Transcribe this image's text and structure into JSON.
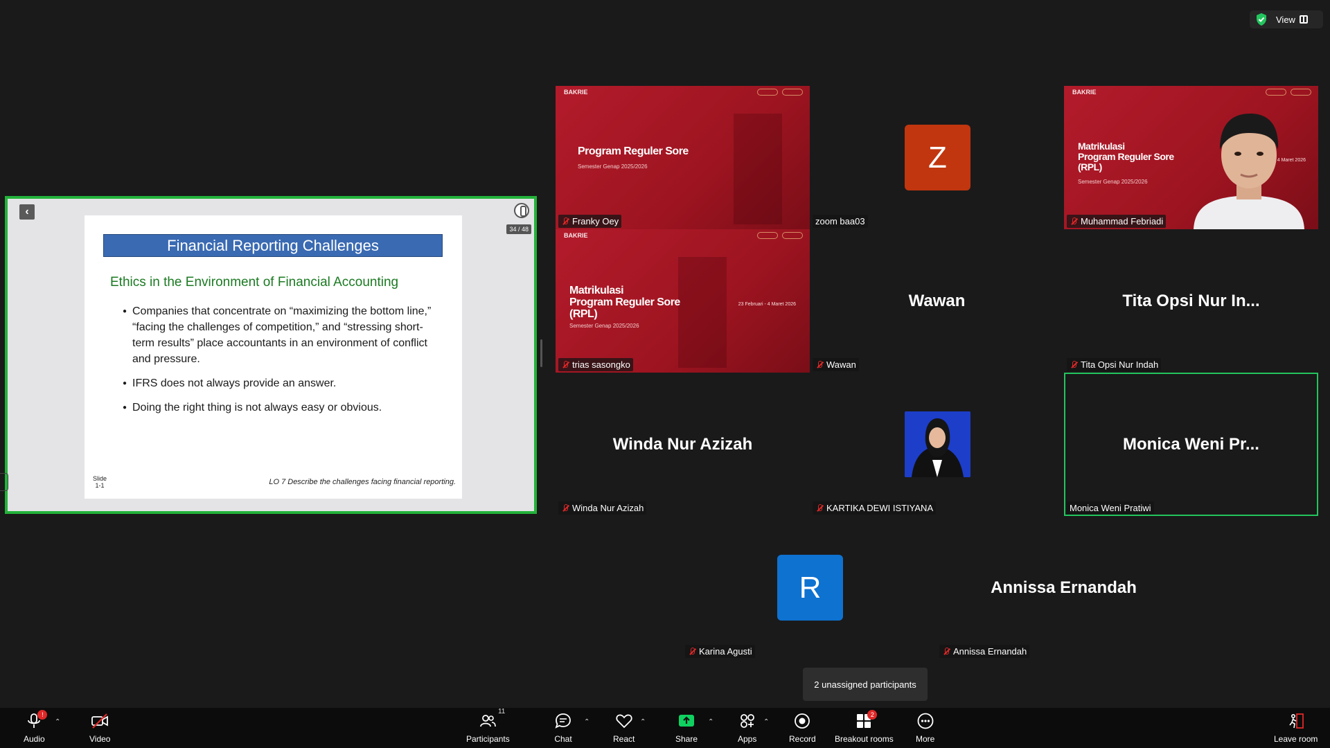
{
  "topbar": {
    "view_label": "View"
  },
  "share": {
    "page_count": "34 / 48",
    "slide_title": "Financial Reporting Challenges",
    "slide_subtitle": "Ethics in the Environment of Financial Accounting",
    "bullets": [
      "Companies that concentrate on “maximizing the bottom line,” “facing the challenges of competition,” and “stressing short-term results” place accountants in an environment of conflict and pressure.",
      "IFRS does not always provide an answer.",
      "Doing the right thing is not always easy or obvious."
    ],
    "slide_label": "Slide",
    "slide_number": "1-1",
    "lo_text": "LO 7  Describe the challenges facing financial reporting."
  },
  "tiles": {
    "franky": {
      "name": "Franky Oey",
      "logo": "BAKRIE",
      "title": "Program Reguler Sore",
      "subtitle": "Semester Genap 2025/2026"
    },
    "zoom_baa": {
      "name": "zoom baa03",
      "avatar_letter": "Z",
      "avatar_color": "#c1360f"
    },
    "febriadi": {
      "name": "Muhammad Febriadi",
      "logo": "BAKRIE",
      "title_lines": [
        "Matrikulasi",
        "Program Reguler Sore",
        "(RPL)"
      ],
      "subtitle": "Semester Genap 2025/2026",
      "date": "ari - 4 Maret 2026"
    },
    "trias": {
      "name": "trias sasongko",
      "logo": "BAKRIE",
      "title_lines": [
        "Matrikulasi",
        "Program Reguler Sore",
        "(RPL)"
      ],
      "subtitle": "Semester Genap 2025/2026",
      "date": "23 Februari - 4 Maret 2026"
    },
    "wawan": {
      "name": "Wawan",
      "display": "Wawan"
    },
    "tita": {
      "name": "Tita Opsi Nur Indah",
      "display": "Tita Opsi Nur In..."
    },
    "winda": {
      "name": "Winda Nur Azizah",
      "display": "Winda Nur Azizah"
    },
    "kartika": {
      "name": "KARTIKA DEWI ISTIYANA"
    },
    "monica": {
      "name": "Monica Weni Pratiwi",
      "display": "Monica Weni Pr..."
    },
    "karina": {
      "name": "Karina Agusti",
      "avatar_letter": "R",
      "avatar_color": "#0e72d1"
    },
    "annissa": {
      "name": "Annissa Ernandah",
      "display": "Annissa Ernandah"
    }
  },
  "tooltip": "2 unassigned participants",
  "toolbar": {
    "audio": "Audio",
    "audio_badge": "!",
    "video": "Video",
    "participants": "Participants",
    "participants_count": "11",
    "chat": "Chat",
    "react": "React",
    "share": "Share",
    "apps": "Apps",
    "record": "Record",
    "breakout": "Breakout rooms",
    "breakout_badge": "2",
    "more": "More",
    "leave": "Leave room"
  },
  "colors": {
    "accent_green": "#23b33a",
    "share_green": "#0fd160",
    "mute_red": "#e02828",
    "tile_red": "#b31b2b"
  },
  "icons": [
    "shield-icon",
    "view-icon",
    "back-arrow-icon",
    "annotate-icon",
    "mic-muted-icon",
    "mic-icon",
    "video-off-icon",
    "participants-icon",
    "chat-icon",
    "react-icon",
    "share-screen-icon",
    "apps-icon",
    "record-icon",
    "breakout-rooms-icon",
    "more-icon",
    "leave-room-icon",
    "chevron-up-icon"
  ]
}
